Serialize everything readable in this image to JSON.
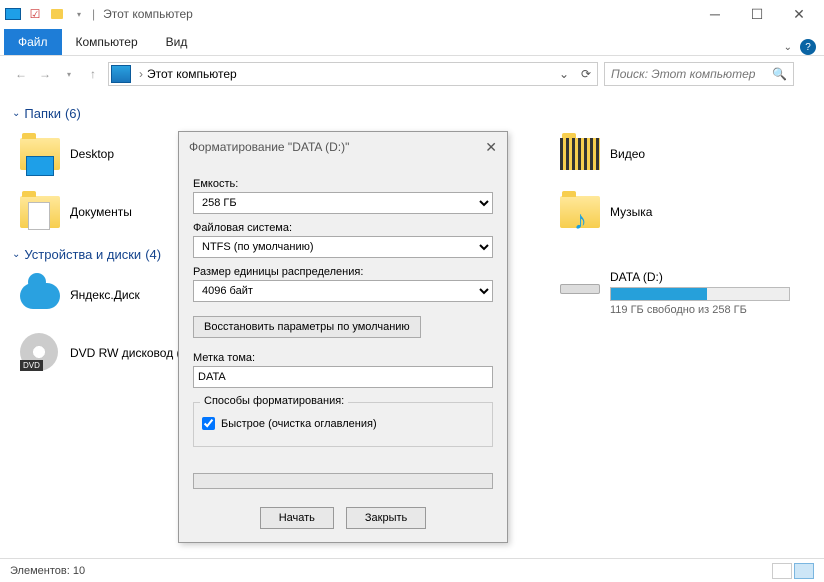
{
  "titlebar": {
    "title": "Этот компьютер"
  },
  "ribbon": {
    "file": "Файл",
    "computer": "Компьютер",
    "view": "Вид"
  },
  "addressbar": {
    "path": "Этот компьютер",
    "chevron": "›"
  },
  "search": {
    "placeholder": "Поиск: Этот компьютер"
  },
  "groups": {
    "folders": {
      "label": "Папки",
      "count": "(6)"
    },
    "devices": {
      "label": "Устройства и диски",
      "count": "(4)"
    }
  },
  "items": {
    "desktop": "Desktop",
    "video": "Видео",
    "documents": "Документы",
    "music": "Музыка",
    "yandex": "Яндекс.Диск",
    "dvd": "DVD RW дисковод (",
    "data_drive": {
      "label": "DATA (D:)",
      "sub": "119 ГБ свободно из 258 ГБ",
      "fill_pct": 54
    }
  },
  "dialog": {
    "title": "Форматирование \"DATA (D:)\"",
    "capacity_label": "Емкость:",
    "capacity_value": "258 ГБ",
    "fs_label": "Файловая система:",
    "fs_value": "NTFS (по умолчанию)",
    "alloc_label": "Размер единицы распределения:",
    "alloc_value": "4096 байт",
    "restore_btn": "Восстановить параметры по умолчанию",
    "volume_label": "Метка тома:",
    "volume_value": "DATA",
    "methods_label": "Способы форматирования:",
    "quick_label": "Быстрое (очистка оглавления)",
    "quick_checked": true,
    "start_btn": "Начать",
    "close_btn": "Закрыть"
  },
  "statusbar": {
    "elements_label": "Элементов:",
    "elements_count": "10"
  }
}
